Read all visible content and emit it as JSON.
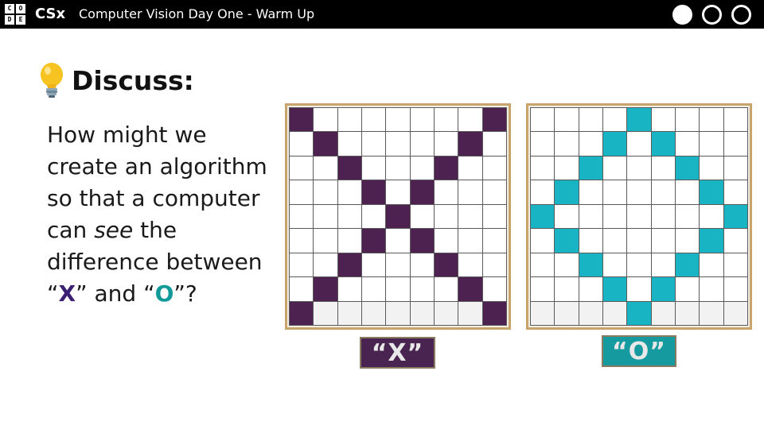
{
  "header": {
    "logo_letters": [
      "C",
      "O",
      "D",
      "E"
    ],
    "brand": "CSx",
    "title": "Computer Vision Day One - Warm Up",
    "progress": {
      "total": 3,
      "filled": 1
    }
  },
  "slide": {
    "heading": "Discuss:",
    "prompt": {
      "line1": "How might we create an algorithm so that a computer can ",
      "see": "see",
      "line2": " the difference between “",
      "x": "X",
      "line3": "” and “",
      "o": "O",
      "line4": "”?"
    }
  },
  "grids": {
    "x": {
      "label": "“X”",
      "fill_color": "#4e2250",
      "cells": [
        [
          1,
          0,
          0,
          0,
          0,
          0,
          0,
          0,
          1
        ],
        [
          0,
          1,
          0,
          0,
          0,
          0,
          0,
          1,
          0
        ],
        [
          0,
          0,
          1,
          0,
          0,
          0,
          1,
          0,
          0
        ],
        [
          0,
          0,
          0,
          1,
          0,
          1,
          0,
          0,
          0
        ],
        [
          0,
          0,
          0,
          0,
          1,
          0,
          0,
          0,
          0
        ],
        [
          0,
          0,
          0,
          1,
          0,
          1,
          0,
          0,
          0
        ],
        [
          0,
          0,
          1,
          0,
          0,
          0,
          1,
          0,
          0
        ],
        [
          0,
          1,
          0,
          0,
          0,
          0,
          0,
          1,
          0
        ],
        [
          1,
          0,
          0,
          0,
          0,
          0,
          0,
          0,
          1
        ]
      ]
    },
    "o": {
      "label": "“O”",
      "fill_color": "#19b4c4",
      "cells": [
        [
          0,
          0,
          0,
          0,
          1,
          0,
          0,
          0,
          0
        ],
        [
          0,
          0,
          0,
          1,
          0,
          1,
          0,
          0,
          0
        ],
        [
          0,
          0,
          1,
          0,
          0,
          0,
          1,
          0,
          0
        ],
        [
          0,
          1,
          0,
          0,
          0,
          0,
          0,
          1,
          0
        ],
        [
          1,
          0,
          0,
          0,
          0,
          0,
          0,
          0,
          1
        ],
        [
          0,
          1,
          0,
          0,
          0,
          0,
          0,
          1,
          0
        ],
        [
          0,
          0,
          1,
          0,
          0,
          0,
          1,
          0,
          0
        ],
        [
          0,
          0,
          0,
          1,
          0,
          1,
          0,
          0,
          0
        ],
        [
          0,
          0,
          0,
          0,
          1,
          0,
          0,
          0,
          0
        ]
      ]
    }
  }
}
